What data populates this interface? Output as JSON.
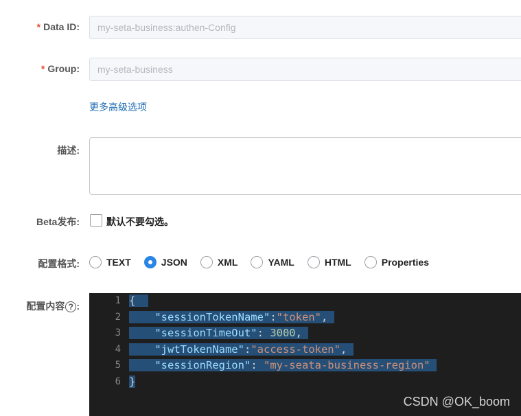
{
  "form": {
    "data_id": {
      "label": "Data ID:",
      "required_mark": "*",
      "value": "my-seta-business:authen-Config"
    },
    "group": {
      "label": "Group:",
      "required_mark": "*",
      "value": "my-seta-business"
    },
    "advanced_link": "更多高级选项",
    "description": {
      "label": "描述:",
      "value": ""
    },
    "beta": {
      "label": "Beta发布:",
      "checkbox_text": "默认不要勾选。",
      "checked": false
    },
    "format": {
      "label": "配置格式:",
      "options": [
        "TEXT",
        "JSON",
        "XML",
        "YAML",
        "HTML",
        "Properties"
      ],
      "selected": "JSON"
    },
    "content": {
      "label": "配置内容",
      "help_icon": "question-circle-icon",
      "help_glyph": "?",
      "line_numbers": [
        "1",
        "2",
        "3",
        "4",
        "5",
        "6"
      ],
      "code": {
        "l1": {
          "brace": "{"
        },
        "l2": {
          "key": "\"sessionTokenName\"",
          "colon": ":",
          "value": "\"token\"",
          "comma": ","
        },
        "l3": {
          "key": "\"sessionTimeOut\"",
          "colon": ": ",
          "value": "3000",
          "comma": ","
        },
        "l4": {
          "key": "\"jwtTokenName\"",
          "colon": ":",
          "value": "\"access-token\"",
          "comma": ","
        },
        "l5": {
          "key": "\"sessionRegion\"",
          "colon": ": ",
          "value": "\"my-seata-business-region\""
        },
        "l6": {
          "brace": "}"
        }
      }
    }
  },
  "watermark": "CSDN @OK_boom",
  "colors": {
    "accent": "#2b85e4",
    "required": "#e34b2e",
    "link": "#1a6ab3",
    "editor_bg": "#1e1e1e",
    "selection": "#264f78"
  }
}
